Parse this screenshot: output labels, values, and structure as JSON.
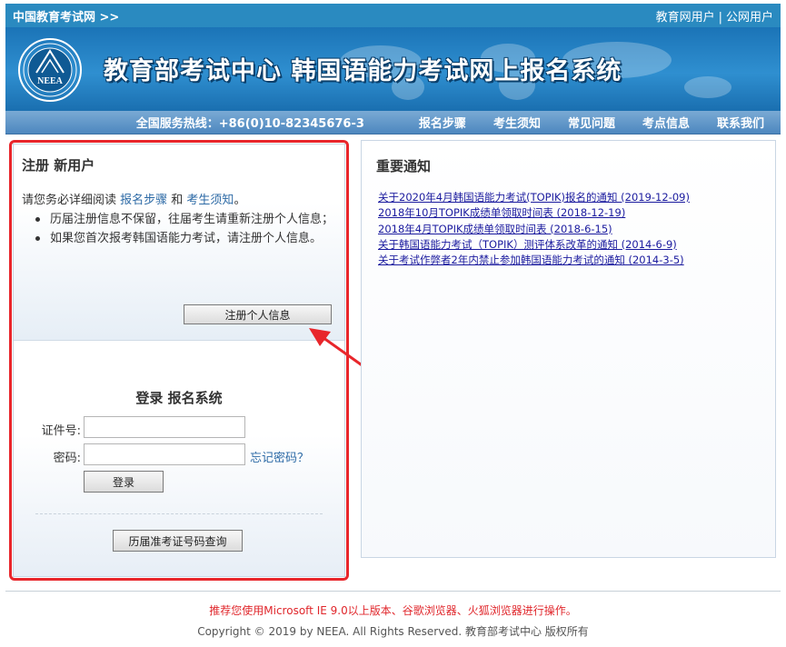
{
  "topbar": {
    "site_link": "中国教育考试网 >>",
    "edu_user": "教育网用户",
    "separator": "|",
    "public_user": "公网用户"
  },
  "banner": {
    "logo_text": "NEEA",
    "title": "教育部考试中心  韩国语能力考试网上报名系统"
  },
  "nav": {
    "hotline": "全国服务热线：+86(0)10-82345676-3",
    "items": [
      "报名步骤",
      "考生须知",
      "常见问题",
      "考点信息",
      "联系我们"
    ]
  },
  "register": {
    "title": "注册 新用户",
    "intro_prefix": "请您务必详细阅读 ",
    "intro_link1": "报名步骤",
    "intro_and": " 和 ",
    "intro_link2": "考生须知",
    "intro_suffix": "。",
    "bullets": [
      "历届注册信息不保留，往届考生请重新注册个人信息；",
      "如果您首次报考韩国语能力考试，请注册个人信息。"
    ],
    "button": "注册个人信息"
  },
  "login": {
    "title": "登录 报名系统",
    "id_label": "证件号:",
    "id_value": "",
    "password_label": "密码:",
    "password_value": "",
    "forgot": "忘记密码？",
    "button": "登录",
    "query_button": "历届准考证号码查询"
  },
  "notices": {
    "title": "重要通知",
    "items": [
      "关于2020年4月韩国语能力考试(TOPIK)报名的通知 (2019-12-09)",
      "2018年10月TOPIK成绩单领取时间表 (2018-12-19)",
      "2018年4月TOPIK成绩单领取时间表 (2018-6-15)",
      "关于韩国语能力考试（TOPIK）测评体系改革的通知 (2014-6-9)",
      "关于考试作弊者2年内禁止参加韩国语能力考试的通知 (2014-3-5)"
    ]
  },
  "footer": {
    "note": "推荐您使用Microsoft IE 9.0以上版本、谷歌浏览器、火狐浏览器进行操作。",
    "copyright": "Copyright © 2019 by NEEA. All Rights Reserved. 教育部考试中心 版权所有"
  },
  "colors": {
    "accent": "#2a8ac0",
    "highlight": "#e8262b",
    "link": "#1a1a9e"
  }
}
